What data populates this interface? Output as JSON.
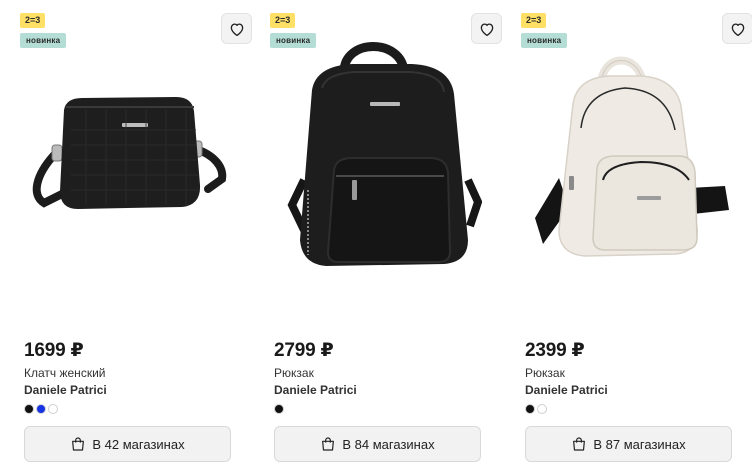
{
  "products": [
    {
      "promo_badge": "2=3",
      "new_badge": "новинка",
      "price": "1699 ₽",
      "category": "Клатч женский",
      "brand": "Daniele Patrici",
      "colors": [
        "#111111",
        "#1633e6",
        "#ffffff"
      ],
      "stores_label": "В 42 магазинах",
      "image_icon": "black-clutch-bag"
    },
    {
      "promo_badge": "2=3",
      "new_badge": "новинка",
      "price": "2799 ₽",
      "category": "Рюкзак",
      "brand": "Daniele Patrici",
      "colors": [
        "#111111"
      ],
      "stores_label": "В 84 магазинах",
      "image_icon": "black-backpack"
    },
    {
      "promo_badge": "2=3",
      "new_badge": "новинка",
      "price": "2399 ₽",
      "category": "Рюкзак",
      "brand": "Daniele Patrici",
      "colors": [
        "#111111",
        "#ffffff"
      ],
      "stores_label": "В 87 магазинах",
      "image_icon": "cream-backpack"
    }
  ],
  "icons": {
    "favorite": "heart-icon",
    "stores": "shopping-bag-icon"
  }
}
